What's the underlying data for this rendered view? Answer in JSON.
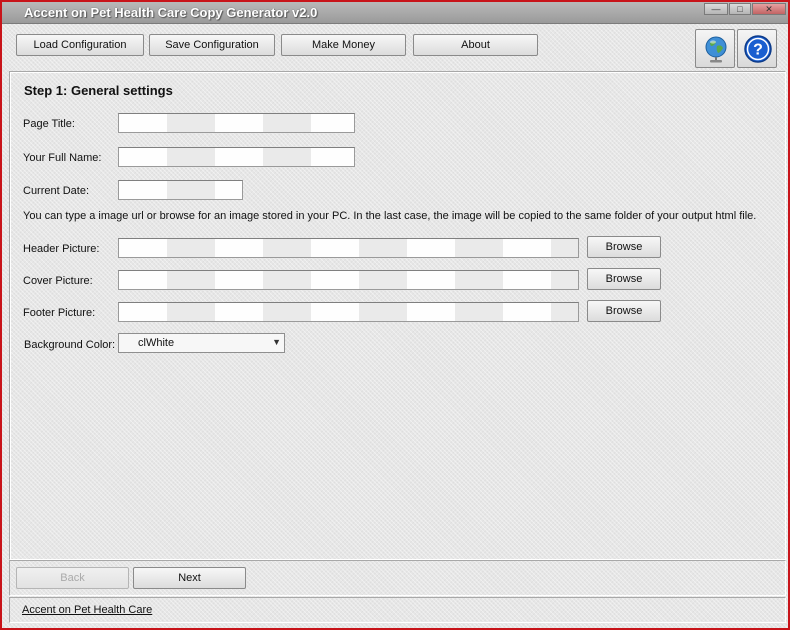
{
  "window": {
    "title": "Accent on Pet Health Care Copy Generator v2.0",
    "controls": {
      "minimize": "—",
      "maximize": "□",
      "close": "✕"
    }
  },
  "toolbar": {
    "buttons": [
      {
        "label": "Load Configuration"
      },
      {
        "label": "Save Configuration"
      },
      {
        "label": "Make Money"
      },
      {
        "label": "About"
      }
    ],
    "icons": [
      "globe-icon",
      "help-icon"
    ]
  },
  "step": {
    "title": "Step 1: General settings",
    "fields": {
      "page_title": {
        "label": "Page Title:",
        "value": ""
      },
      "full_name": {
        "label": "Your Full Name:",
        "value": ""
      },
      "current_date": {
        "label": "Current Date:",
        "value": ""
      }
    },
    "info_text": "You can type a image url or browse for an image stored in your PC. In the last case, the image will be copied to the same folder of your output html file.",
    "pictures": {
      "header": {
        "label": "Header Picture:",
        "value": "",
        "browse_label": "Browse"
      },
      "cover": {
        "label": "Cover Picture:",
        "value": "",
        "browse_label": "Browse"
      },
      "footer": {
        "label": "Footer Picture:",
        "value": "",
        "browse_label": "Browse"
      }
    },
    "background_color": {
      "label": "Background Color:",
      "selected": "clWhite"
    }
  },
  "navigation": {
    "back_label": "Back",
    "next_label": "Next"
  },
  "status": {
    "link_text": "Accent on Pet Health Care"
  },
  "colors": {
    "border_accent": "#c8141a",
    "help_blue": "#1a5fd0"
  }
}
